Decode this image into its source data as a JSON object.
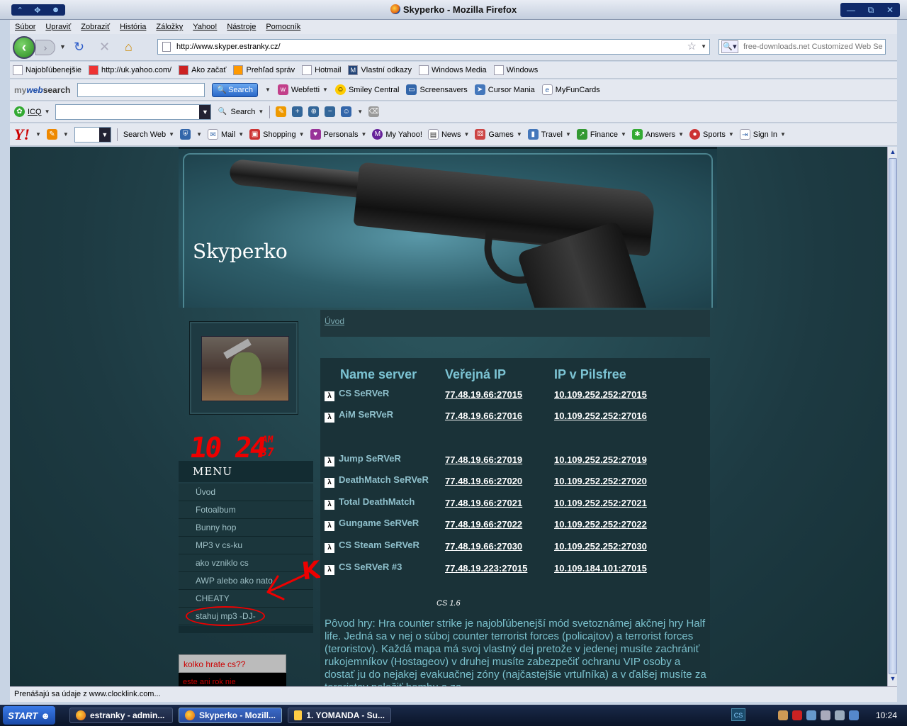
{
  "window": {
    "title": "Skyperko - Mozilla Firefox"
  },
  "menu": [
    "Súbor",
    "Upraviť",
    "Zobraziť",
    "História",
    "Záložky",
    "Yahoo!",
    "Nástroje",
    "Pomocník"
  ],
  "nav": {
    "url": "http://www.skyper.estranky.cz/",
    "search_placeholder": "free-downloads.net Customized Web Se"
  },
  "bookmarks": [
    "Najobľúbenejšie",
    "http://uk.yahoo.com/",
    "Ako začať",
    "Prehľad správ",
    "Hotmail",
    "Vlastní odkazy",
    "Windows Media",
    "Windows"
  ],
  "toolbar1": {
    "search_button": "Search",
    "items": [
      "Webfetti",
      "Smiley Central",
      "Screensavers",
      "Cursor Mania",
      "MyFunCards"
    ]
  },
  "toolbar2": {
    "icq": "ICQ",
    "search": "Search"
  },
  "toolbar3": {
    "search_web": "Search Web",
    "items": [
      "Mail",
      "Shopping",
      "Personals",
      "My Yahoo!",
      "News",
      "Games",
      "Travel",
      "Finance",
      "Answers",
      "Sports",
      "Sign In"
    ]
  },
  "site": {
    "name": "Skyperko",
    "breadcrumb": "Úvod",
    "menu_title": "MENU"
  },
  "clock": {
    "time": "10 24",
    "ampm": "AM",
    "seconds": "37"
  },
  "menu_items": [
    "Úvod",
    "Fotoalbum",
    "Bunny hop",
    "MP3 v cs-ku",
    "ako vzniklo cs",
    "AWP alebo ako nato",
    "CHEATY",
    "stahuj mp3 -DJ-"
  ],
  "annotation": {
    "klik": "KLIK"
  },
  "servers": {
    "headers": [
      "Name server",
      "Veřejná IP",
      "IP v Pilsfree"
    ],
    "rows": [
      {
        "name": "CS SeRVeR",
        "public": "77.48.19.66:27015",
        "pilsfree": "10.109.252.252:27015"
      },
      {
        "name": "AiM SeRVeR",
        "public": "77.48.19.66:27016",
        "pilsfree": "10.109.252.252:27016"
      },
      {
        "name": "",
        "public": "",
        "pilsfree": ""
      },
      {
        "name": "Jump SeRVeR",
        "public": "77.48.19.66:27019",
        "pilsfree": "10.109.252.252:27019"
      },
      {
        "name": "DeathMatch SeRVeR",
        "public": "77.48.19.66:27020",
        "pilsfree": "10.109.252.252:27020"
      },
      {
        "name": "Total DeathMatch",
        "public": "77.48.19.66:27021",
        "pilsfree": "10.109.252.252:27021"
      },
      {
        "name": "Gungame SeRVeR",
        "public": "77.48.19.66:27022",
        "pilsfree": "10.109.252.252:27022"
      },
      {
        "name": "CS Steam SeRVeR",
        "public": "77.48.19.66:27030",
        "pilsfree": "10.109.252.252:27030"
      },
      {
        "name": "CS SeRVeR #3",
        "public": "77.48.19.223:27015",
        "pilsfree": "10.109.184.101:27015"
      }
    ]
  },
  "cs16": "CS 1.6",
  "description": "Pôvod hry: Hra counter strike je najobľúbenejší mód svetoznámej akčnej hry Half life. Jedná sa v nej o súboj counter terrorist forces (policajtov) a terrorist forces (teroristov). Každá mapa má svoj vlastný dej pretože v jedenej musíte zachrániť rukojemníkov (Hostageov) v druhej musíte zabezpečiť ochranu VIP osoby a dostať ju do nejakej evakuačnej zóny (najčastejšie vrtuľníka) a v ďalšej musíte za teroristov položiť bombu a za",
  "poll": {
    "question": "kolko hrate cs??",
    "answer": "este ani rok nie"
  },
  "status": "Prenášajú sa údaje z www.clocklink.com...",
  "taskbar": {
    "start": "START",
    "tasks": [
      "estranky - admin...",
      "Skyperko - Mozill...",
      "1. YOMANDA - Su..."
    ],
    "tray_cs": "CS",
    "time": "10:24"
  }
}
